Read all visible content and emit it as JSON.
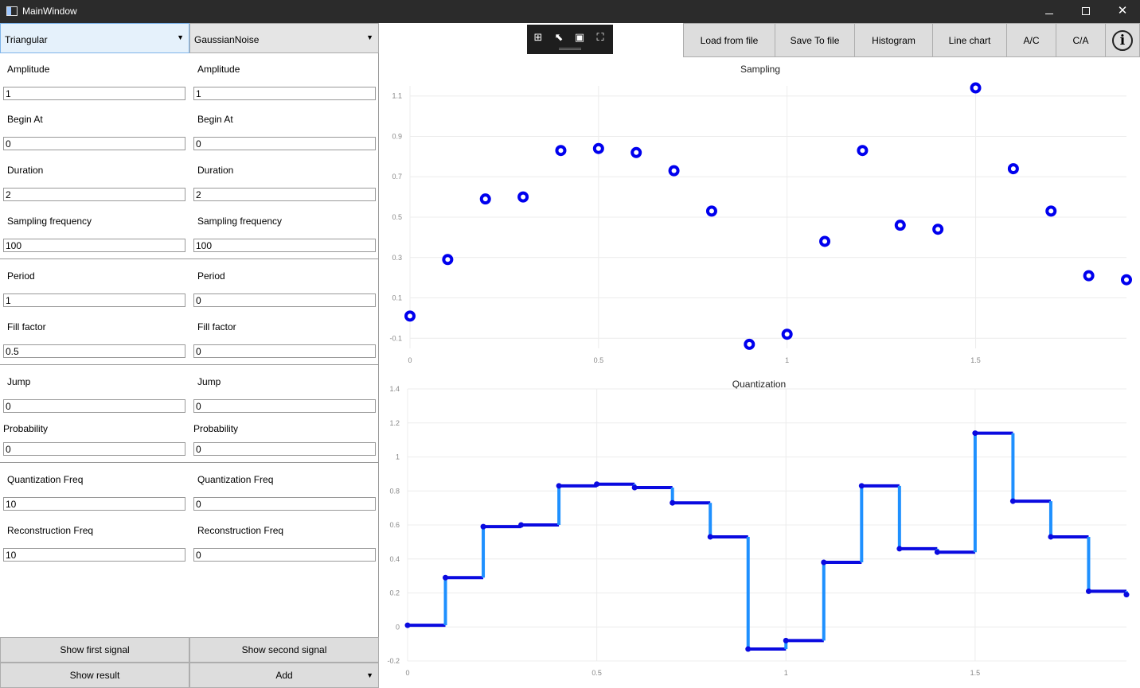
{
  "window": {
    "title": "MainWindow"
  },
  "left": {
    "combo1": "Triangular",
    "combo2": "GaussianNoise",
    "fields": [
      {
        "label": "Amplitude",
        "v1": "1",
        "v2": "1"
      },
      {
        "label": "Begin At",
        "v1": "0",
        "v2": "0"
      },
      {
        "label": "Duration",
        "v1": "2",
        "v2": "2"
      },
      {
        "label": "Sampling frequency",
        "v1": "100",
        "v2": "100"
      },
      {
        "label": "Period",
        "v1": "1",
        "v2": "0"
      },
      {
        "label": "Fill factor",
        "v1": "0.5",
        "v2": "0"
      },
      {
        "label": "Jump",
        "v1": "0",
        "v2": "0"
      },
      {
        "label": "Probability",
        "v1": "0",
        "v2": "0"
      },
      {
        "label": "Quantization Freq",
        "v1": "10",
        "v2": "0"
      },
      {
        "label": "Reconstruction Freq",
        "v1": "10",
        "v2": "0"
      }
    ],
    "buttons": {
      "show_first": "Show first signal",
      "show_second": "Show second signal",
      "show_result": "Show result",
      "operation": "Add"
    }
  },
  "toolbar": {
    "load": "Load from file",
    "save": "Save To file",
    "histogram": "Histogram",
    "line_chart": "Line chart",
    "ac": "A/C",
    "ca": "C/A",
    "info_icon": "info-icon",
    "icons": [
      "add-view-icon",
      "select-cursor-icon",
      "reset-view-icon",
      "zoom-select-icon"
    ]
  },
  "colors": {
    "marker": "#0000ee",
    "step_line": "#1e90ff",
    "step_level": "#0a0ae0",
    "grid": "#ececec"
  },
  "chart_data": [
    {
      "type": "scatter",
      "title": "Sampling",
      "xlim": [
        0,
        1.9
      ],
      "ylim": [
        -0.15,
        1.15
      ],
      "xticks": [
        0,
        0.5,
        1,
        1.5
      ],
      "yticks": [
        -0.1,
        0.1,
        0.3,
        0.5,
        0.7,
        0.9,
        1.1
      ],
      "x": [
        0,
        0.1,
        0.2,
        0.3,
        0.4,
        0.5,
        0.6,
        0.7,
        0.8,
        0.9,
        1.0,
        1.1,
        1.2,
        1.3,
        1.4,
        1.5,
        1.6,
        1.7,
        1.8,
        1.9
      ],
      "y": [
        0.01,
        0.29,
        0.59,
        0.6,
        0.83,
        0.84,
        0.82,
        0.73,
        0.53,
        -0.13,
        -0.08,
        0.38,
        0.83,
        0.46,
        0.44,
        1.14,
        0.74,
        0.53,
        0.21,
        0.19
      ]
    },
    {
      "type": "line",
      "title": "Quantization",
      "step": true,
      "xlim": [
        0,
        1.9
      ],
      "ylim": [
        -0.2,
        1.4
      ],
      "xticks": [
        0,
        0.5,
        1,
        1.5
      ],
      "yticks": [
        -0.2,
        0,
        0.2,
        0.4,
        0.6,
        0.8,
        1,
        1.2,
        1.4
      ],
      "x": [
        0,
        0.1,
        0.2,
        0.3,
        0.4,
        0.5,
        0.6,
        0.7,
        0.8,
        0.9,
        1.0,
        1.1,
        1.2,
        1.3,
        1.4,
        1.5,
        1.6,
        1.7,
        1.8,
        1.9
      ],
      "y": [
        0.01,
        0.29,
        0.59,
        0.6,
        0.83,
        0.84,
        0.82,
        0.73,
        0.53,
        -0.13,
        -0.08,
        0.38,
        0.83,
        0.46,
        0.44,
        1.14,
        0.74,
        0.53,
        0.21,
        0.19
      ]
    }
  ]
}
